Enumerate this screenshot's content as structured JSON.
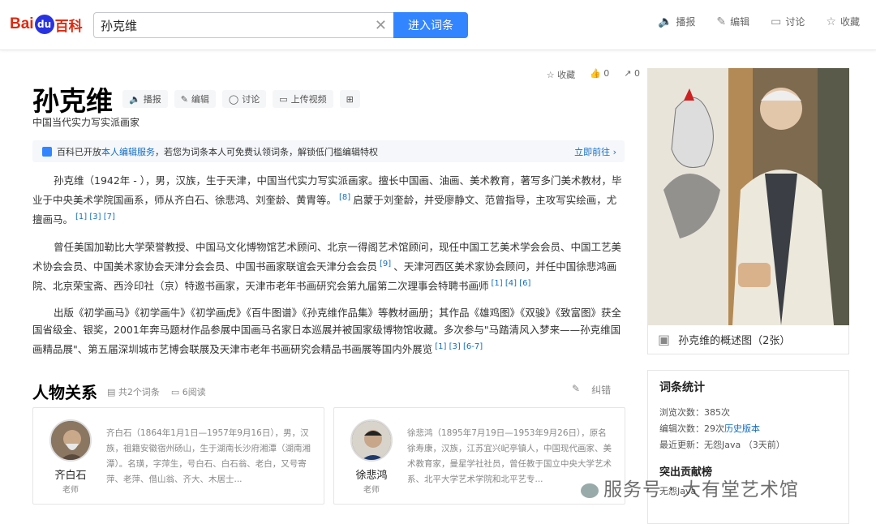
{
  "header": {
    "logo_bai": "Bai",
    "logo_du": "du",
    "logo_baike": "百科",
    "search_value": "孙克维",
    "search_button": "进入词条",
    "tools": [
      "播报",
      "编辑",
      "讨论",
      "收藏"
    ]
  },
  "entry": {
    "title": "孙克维",
    "actions": [
      "播报",
      "编辑",
      "讨论",
      "上传视频"
    ],
    "subtitle": "中国当代实力写实派画家",
    "meta": {
      "favorite": "收藏",
      "likes": "0",
      "shares": "0"
    },
    "notice": {
      "prefix": "百科已开放",
      "link": "本人编辑服务",
      "suffix": "，若您为词条本人可免费认领词条，解锁低门槛编辑特权",
      "go": "立即前往 ›"
    },
    "paragraphs": [
      {
        "text": "孙克维（1942年 - ），男，汉族，生于天津，中国当代实力写实派画家。擅长中国画、油画、美术教育，著写多门美术教材，毕业于中央美术学院国画系，师从齐白石、徐悲鸿、刘奎龄、黄胄等。",
        "ref1": "[8]",
        "text2": "启蒙于刘奎龄，并受廖静文、范曾指导，主攻写实绘画，尤擅画马。",
        "ref2": "[1]  [3]  [7]"
      },
      {
        "text": "曾任美国加勒比大学荣誉教授、中国马文化博物馆艺术顾问、北京一得阁艺术馆顾问，现任中国工艺美术学会会员、中国工艺美术协会会员、中国美术家协会天津分会会员、中国书画家联谊会天津分会会员",
        "ref1": "[9]",
        "text2": "、天津河西区美术家协会顾问，并任中国徐悲鸿画院、北京荣宝斋、西泠印社（京）特邀书画家，天津市老年书画研究会第九届第二次理事会特聘书画师",
        "ref2": "[1]  [4]  [6]"
      },
      {
        "text": "出版《初学画马》《初学画牛》《初学画虎》《百牛图谱》《孙克维作品集》等教材画册；其作品《雄鸡图》《双骏》《致富图》获全国省级金、银奖，2001年奔马题材作品参展中国画马名家日本巡展并被国家级博物馆收藏。多次参与\"马踏清风入梦来——孙克维国画精品展\"、第五届深圳城市艺博会联展及天津市老年书画研究会精品书画展等国内外展览",
        "ref1": "[1]  [3]  [6-7]",
        "text2": "",
        "ref2": ""
      }
    ]
  },
  "relations": {
    "title": "人物关系",
    "count": "共2个词条",
    "reads": "6阅读",
    "correct": "纠错",
    "people": [
      {
        "name": "齐白石",
        "role": "老师",
        "desc": "齐白石（1864年1月1日—1957年9月16日），男，汉族，祖籍安徽宿州砀山，生于湖南长沙府湘潭（湖南湘潭）。名璜，字萍生，号白石、白石翁、老白，又号寄萍、老萍、借山翁、齐大、木居士..."
      },
      {
        "name": "徐悲鸿",
        "role": "老师",
        "desc": "徐悲鸿（1895年7月19日—1953年9月26日），原名徐寿康，汉族，江苏宜兴屺亭镇人，中国现代画家、美术教育家，曼星学社社员，曾任教于国立中央大学艺术系、北平大学艺术学院和北平艺专..."
      }
    ]
  },
  "sidebar": {
    "caption": "孙克维的概述图（2张）",
    "stats_title": "词条统计",
    "views": "浏览次数：385次",
    "edits_prefix": "编辑次数：29次",
    "edits_link": "历史版本",
    "updated": "最近更新：无怨Java （3天前）",
    "contrib_title": "突出贡献榜",
    "contrib_user": "无怨Java"
  },
  "watermark": "服务号 · 大有堂艺术馆"
}
